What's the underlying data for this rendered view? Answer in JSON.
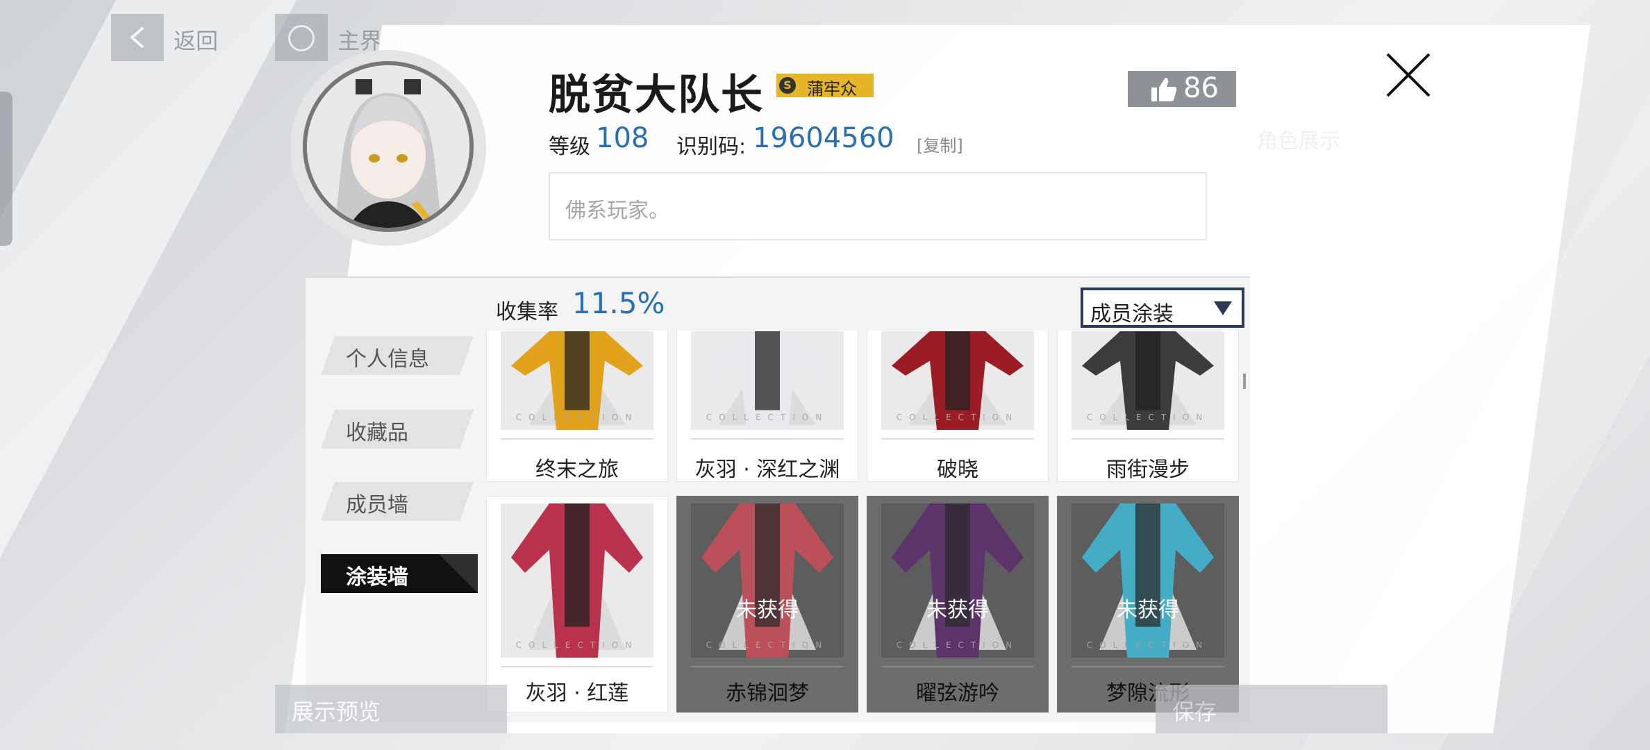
{
  "nav": {
    "back_label": "返回",
    "home_label": "主界面"
  },
  "profile": {
    "username": "脱贫大队长",
    "badge_letter": "S",
    "badge_text": "蒲牢众",
    "likes": "86",
    "level_label": "等级",
    "level": "108",
    "id_label": "识别码:",
    "id": "19604560",
    "copy_label": "[复制]",
    "signature": "佛系玩家。"
  },
  "ghost_label": "角色展示",
  "tabs": [
    "个人信息",
    "收藏品",
    "成员墙",
    "涂装墙"
  ],
  "active_tab": "涂装墙",
  "collection": {
    "label": "收集率",
    "rate": "11.5%"
  },
  "filter": {
    "selected": "成员涂装"
  },
  "card_watermark": "COLLECTION",
  "locked_label": "未获得",
  "cards": [
    {
      "name": "终末之旅",
      "locked": false,
      "color": "#e3a21b"
    },
    {
      "name": "灰羽 · 深红之渊",
      "locked": false,
      "color": "#e8eaed"
    },
    {
      "name": "破晓",
      "locked": false,
      "color": "#9b1c24"
    },
    {
      "name": "雨街漫步",
      "locked": false,
      "color": "#3c3c3c"
    },
    {
      "name": "灰羽 · 红莲",
      "locked": false,
      "color": "#b8324c"
    },
    {
      "name": "赤锦洄梦",
      "locked": true,
      "color": "#c94b55"
    },
    {
      "name": "曜弦游吟",
      "locked": true,
      "color": "#5a2b6b"
    },
    {
      "name": "梦隙流形",
      "locked": true,
      "color": "#3fb8d6"
    }
  ],
  "buttons": {
    "preview": "展示预览",
    "save": "保存"
  }
}
